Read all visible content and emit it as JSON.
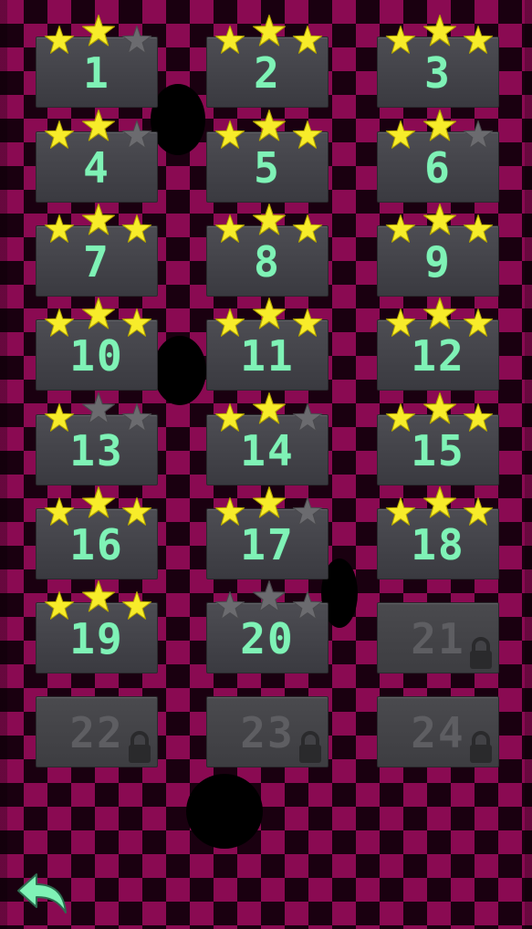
{
  "screen": "level-select",
  "colors": {
    "star_earned": "#f7ec2a",
    "star_empty": "#6b6b6f",
    "number_unlocked": "#7ff2b6",
    "number_locked": "#5e5e62",
    "tile": "#45454b",
    "background": "#8a0a52"
  },
  "levels": [
    {
      "label": "1",
      "stars": 2,
      "locked": false
    },
    {
      "label": "2",
      "stars": 3,
      "locked": false
    },
    {
      "label": "3",
      "stars": 3,
      "locked": false
    },
    {
      "label": "4",
      "stars": 2,
      "locked": false
    },
    {
      "label": "5",
      "stars": 3,
      "locked": false
    },
    {
      "label": "6",
      "stars": 2,
      "locked": false
    },
    {
      "label": "7",
      "stars": 3,
      "locked": false
    },
    {
      "label": "8",
      "stars": 3,
      "locked": false
    },
    {
      "label": "9",
      "stars": 3,
      "locked": false
    },
    {
      "label": "10",
      "stars": 3,
      "locked": false
    },
    {
      "label": "11",
      "stars": 3,
      "locked": false
    },
    {
      "label": "12",
      "stars": 3,
      "locked": false
    },
    {
      "label": "13",
      "stars": 1,
      "locked": false
    },
    {
      "label": "14",
      "stars": 2,
      "locked": false
    },
    {
      "label": "15",
      "stars": 3,
      "locked": false
    },
    {
      "label": "16",
      "stars": 3,
      "locked": false
    },
    {
      "label": "17",
      "stars": 2,
      "locked": false
    },
    {
      "label": "18",
      "stars": 3,
      "locked": false
    },
    {
      "label": "19",
      "stars": 3,
      "locked": false
    },
    {
      "label": "20",
      "stars": 0,
      "locked": false
    },
    {
      "label": "21",
      "stars": 0,
      "locked": true
    },
    {
      "label": "22",
      "stars": 0,
      "locked": true
    },
    {
      "label": "23",
      "stars": 0,
      "locked": true
    },
    {
      "label": "24",
      "stars": 0,
      "locked": true
    }
  ],
  "icons": {
    "back": "back-arrow-icon",
    "lock": "lock-icon",
    "star": "star-icon"
  }
}
